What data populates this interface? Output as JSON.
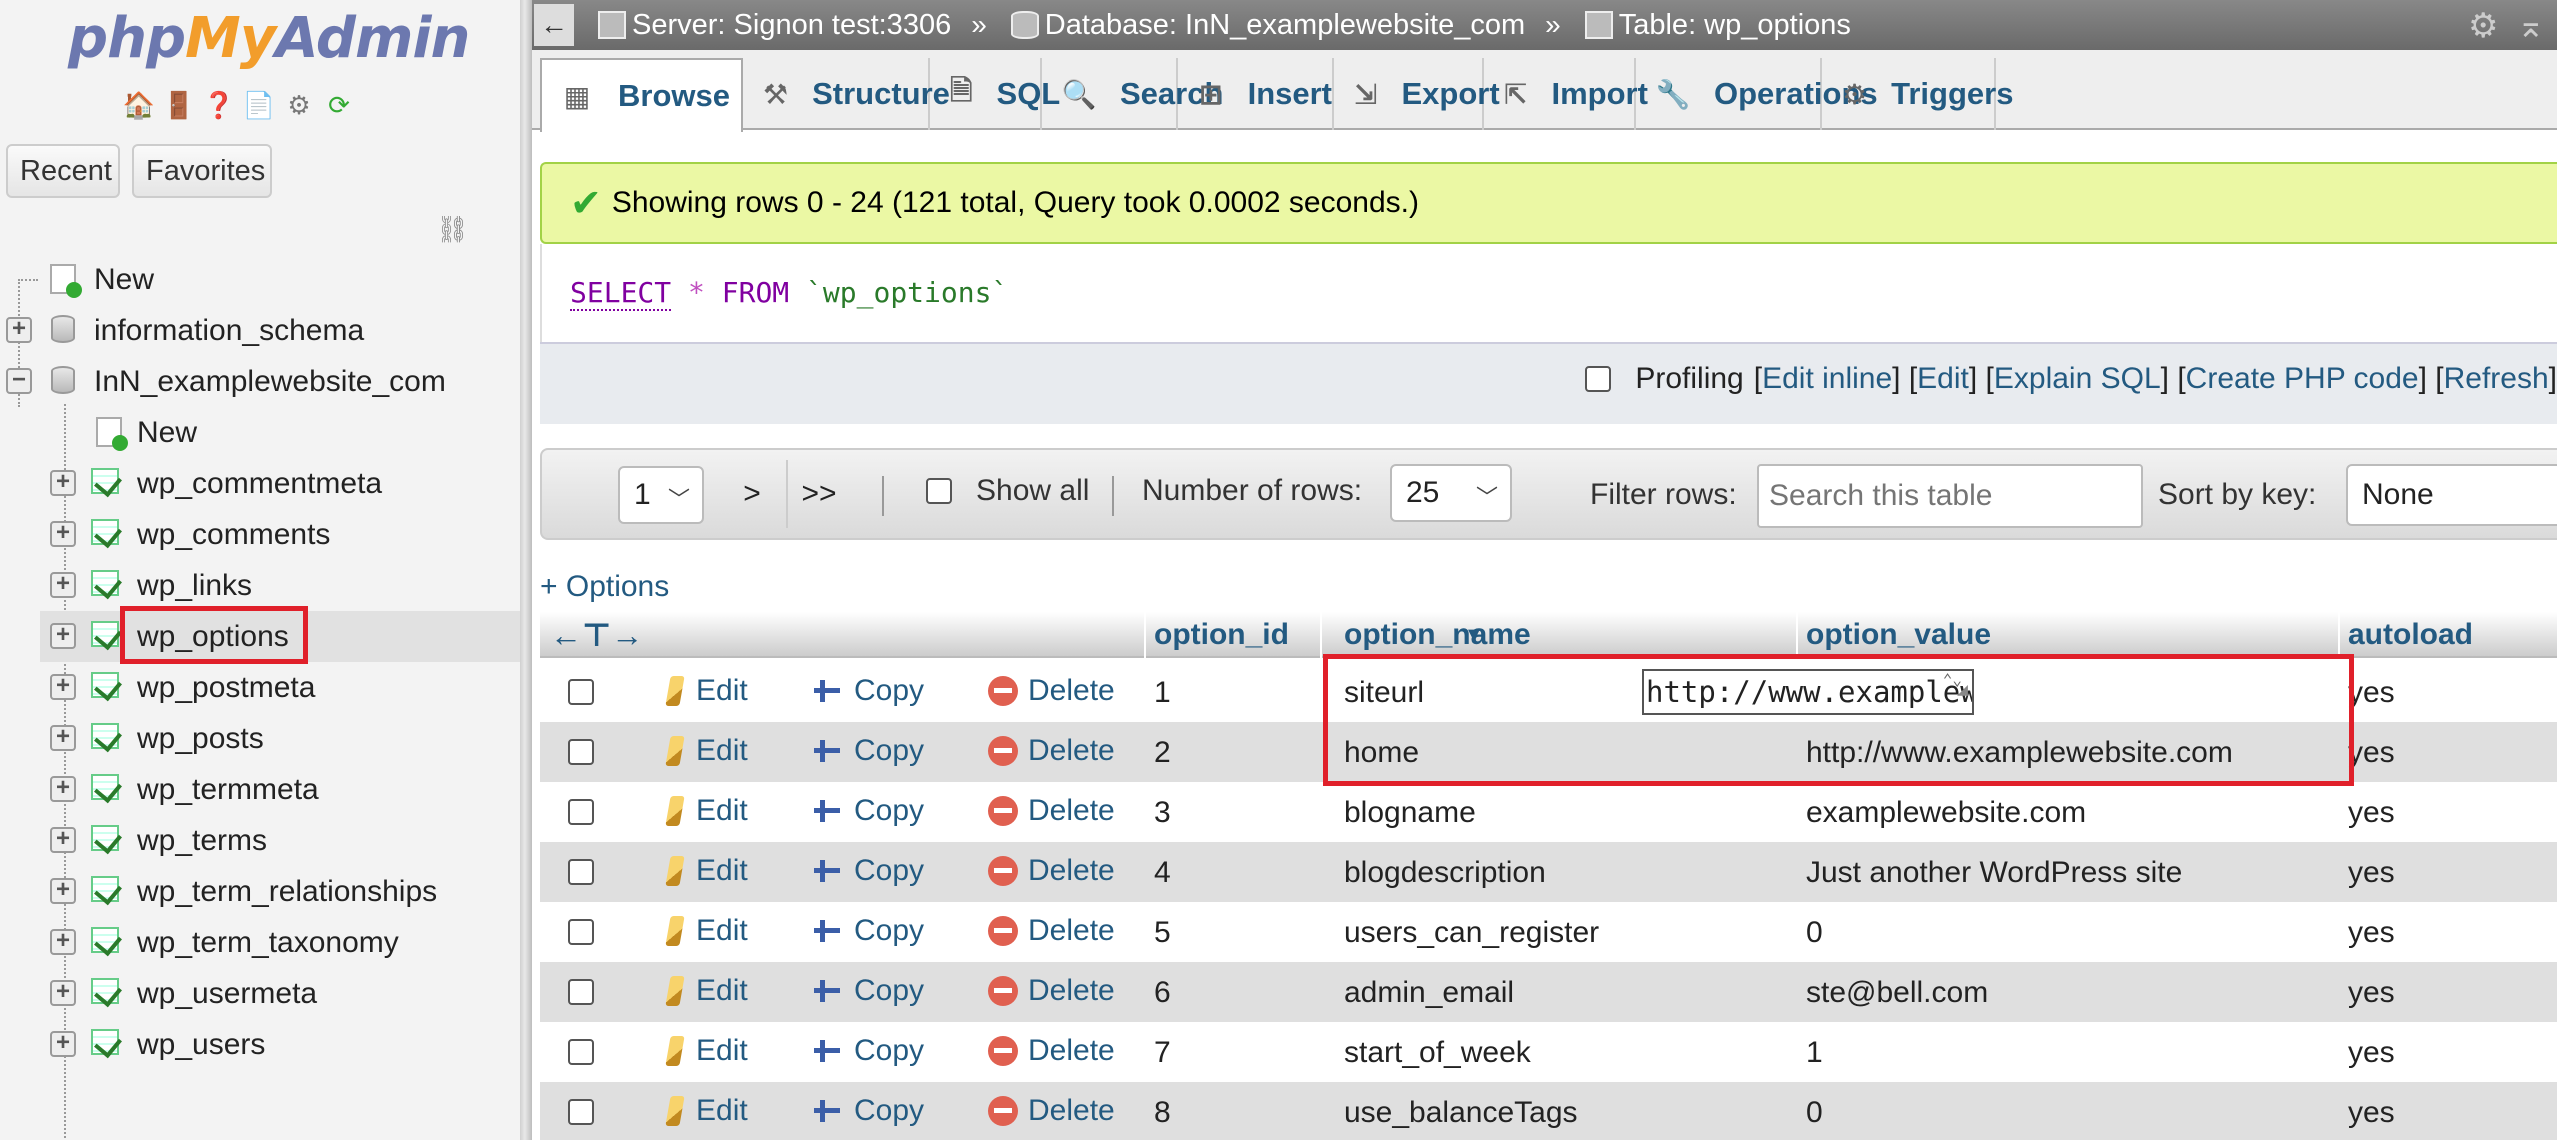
{
  "app": {
    "logo": {
      "php": "php",
      "my": "My",
      "admin": "Admin"
    },
    "nav_buttons": {
      "recent": "Recent",
      "favorites": "Favorites"
    }
  },
  "tree": {
    "new": "New",
    "databases": [
      {
        "name": "information_schema"
      },
      {
        "name": "InN_examplewebsite_com"
      }
    ],
    "db_new": "New",
    "tables": [
      "wp_commentmeta",
      "wp_comments",
      "wp_links",
      "wp_options",
      "wp_postmeta",
      "wp_posts",
      "wp_termmeta",
      "wp_terms",
      "wp_term_relationships",
      "wp_term_taxonomy",
      "wp_usermeta",
      "wp_users"
    ],
    "selected_table": "wp_options"
  },
  "breadcrumb": {
    "server": "Server: Signon test:3306",
    "database": "Database: InN_examplewebsite_com",
    "table": "Table: wp_options",
    "sep": "»"
  },
  "tabs": [
    {
      "label": "Browse",
      "icon": "browse-icon"
    },
    {
      "label": "Structure",
      "icon": "structure-icon"
    },
    {
      "label": "SQL",
      "icon": "sql-icon"
    },
    {
      "label": "Search",
      "icon": "search-icon"
    },
    {
      "label": "Insert",
      "icon": "insert-icon"
    },
    {
      "label": "Export",
      "icon": "export-icon"
    },
    {
      "label": "Import",
      "icon": "import-icon"
    },
    {
      "label": "Operations",
      "icon": "wrench-icon"
    },
    {
      "label": "Triggers",
      "icon": "triggers-icon"
    }
  ],
  "message": "Showing rows 0 - 24 (121 total, Query took 0.0002 seconds.)",
  "sql": {
    "select": "SELECT",
    "star": "*",
    "from": "FROM",
    "table": "`wp_options`"
  },
  "profiling": {
    "label": "Profiling",
    "edit_inline": "Edit inline",
    "edit": "Edit",
    "explain": "Explain SQL",
    "php": "Create PHP code",
    "refresh": "Refresh"
  },
  "navigation": {
    "page": "1",
    "next": ">",
    "last": ">>",
    "show_all": "Show all",
    "rows_label": "Number of rows:",
    "rows_value": "25",
    "filter_label": "Filter rows:",
    "filter_placeholder": "Search this table",
    "sort_label": "Sort by key:",
    "sort_value": "None"
  },
  "options_link": "+ Options",
  "table": {
    "headers": {
      "id": "option_id",
      "name": "option_name",
      "value": "option_value",
      "autoload": "autoload"
    },
    "actions": {
      "edit": "Edit",
      "copy": "Copy",
      "delete": "Delete"
    },
    "rows": [
      {
        "id": "1",
        "name": "siteurl",
        "value": "http://www.examplewebsite",
        "autoload": "yes"
      },
      {
        "id": "2",
        "name": "home",
        "value": "http://www.examplewebsite.com",
        "autoload": "yes"
      },
      {
        "id": "3",
        "name": "blogname",
        "value": "examplewebsite.com",
        "autoload": "yes"
      },
      {
        "id": "4",
        "name": "blogdescription",
        "value": "Just another WordPress site",
        "autoload": "yes"
      },
      {
        "id": "5",
        "name": "users_can_register",
        "value": "0",
        "autoload": "yes"
      },
      {
        "id": "6",
        "name": "admin_email",
        "value": "ste@bell.com",
        "autoload": "yes"
      },
      {
        "id": "7",
        "name": "start_of_week",
        "value": "1",
        "autoload": "yes"
      },
      {
        "id": "8",
        "name": "use_balanceTags",
        "value": "0",
        "autoload": "yes"
      }
    ]
  }
}
